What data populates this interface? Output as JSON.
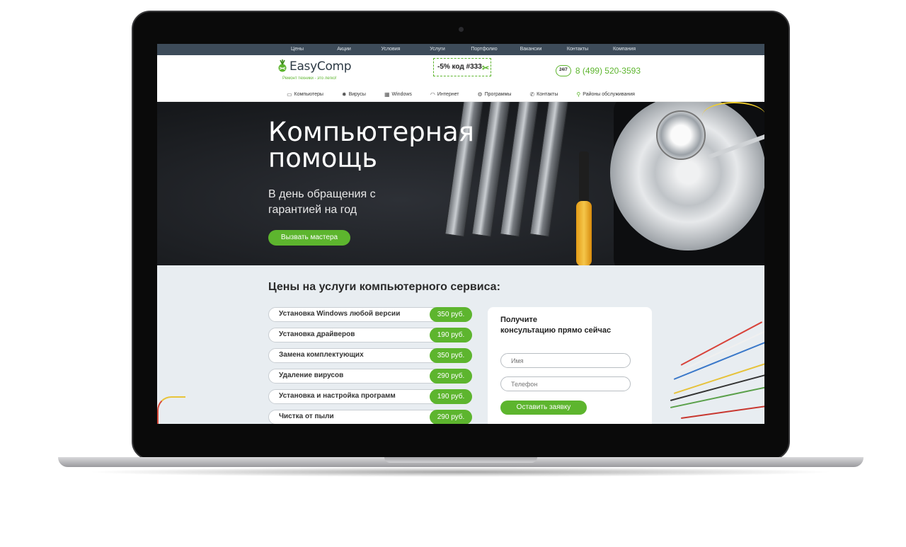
{
  "topnav": [
    "Цены",
    "Акции",
    "Условия",
    "Услуги",
    "Портфолио",
    "Вакансии",
    "Контакты",
    "Компания"
  ],
  "header": {
    "logo_name": "EasyComp",
    "logo_tagline": "Ремонт техники - это легко!",
    "promo": "-5% код #333",
    "clock_label": "24/7",
    "phone": "8 (499) 520-3593"
  },
  "catnav": [
    {
      "label": "Компьютеры",
      "icon": "monitor-icon"
    },
    {
      "label": "Вирусы",
      "icon": "virus-icon"
    },
    {
      "label": "Windows",
      "icon": "windows-icon"
    },
    {
      "label": "Интернет",
      "icon": "wifi-icon"
    },
    {
      "label": "Программы",
      "icon": "gears-icon"
    },
    {
      "label": "Контакты",
      "icon": "phone-icon"
    },
    {
      "label": "Районы обслуживания",
      "icon": "map-pin-icon"
    }
  ],
  "hero": {
    "title_line1": "Компьютерная",
    "title_line2": "помощь",
    "subtitle": "В день обращения с гарантией на год",
    "cta": "Вызвать мастера"
  },
  "prices": {
    "title": "Цены на услуги компьютерного сервиса:",
    "items": [
      {
        "name": "Установка Windows любой версии",
        "price": "350 руб."
      },
      {
        "name": "Установка драйверов",
        "price": "190 руб."
      },
      {
        "name": "Замена комплектующих",
        "price": "350 руб."
      },
      {
        "name": "Удаление вирусов",
        "price": "290 руб."
      },
      {
        "name": "Установка и настройка программ",
        "price": "190 руб."
      },
      {
        "name": "Чистка от пыли",
        "price": "290 руб."
      }
    ]
  },
  "form": {
    "title_line1": "Получите",
    "title_line2": "консультацию прямо сейчас",
    "name_placeholder": "Имя",
    "phone_placeholder": "Телефон",
    "submit": "Оставить заявку"
  },
  "colors": {
    "accent": "#5db52e",
    "topnav_bg": "#3d4b59",
    "content_bg": "#e8edf1"
  }
}
